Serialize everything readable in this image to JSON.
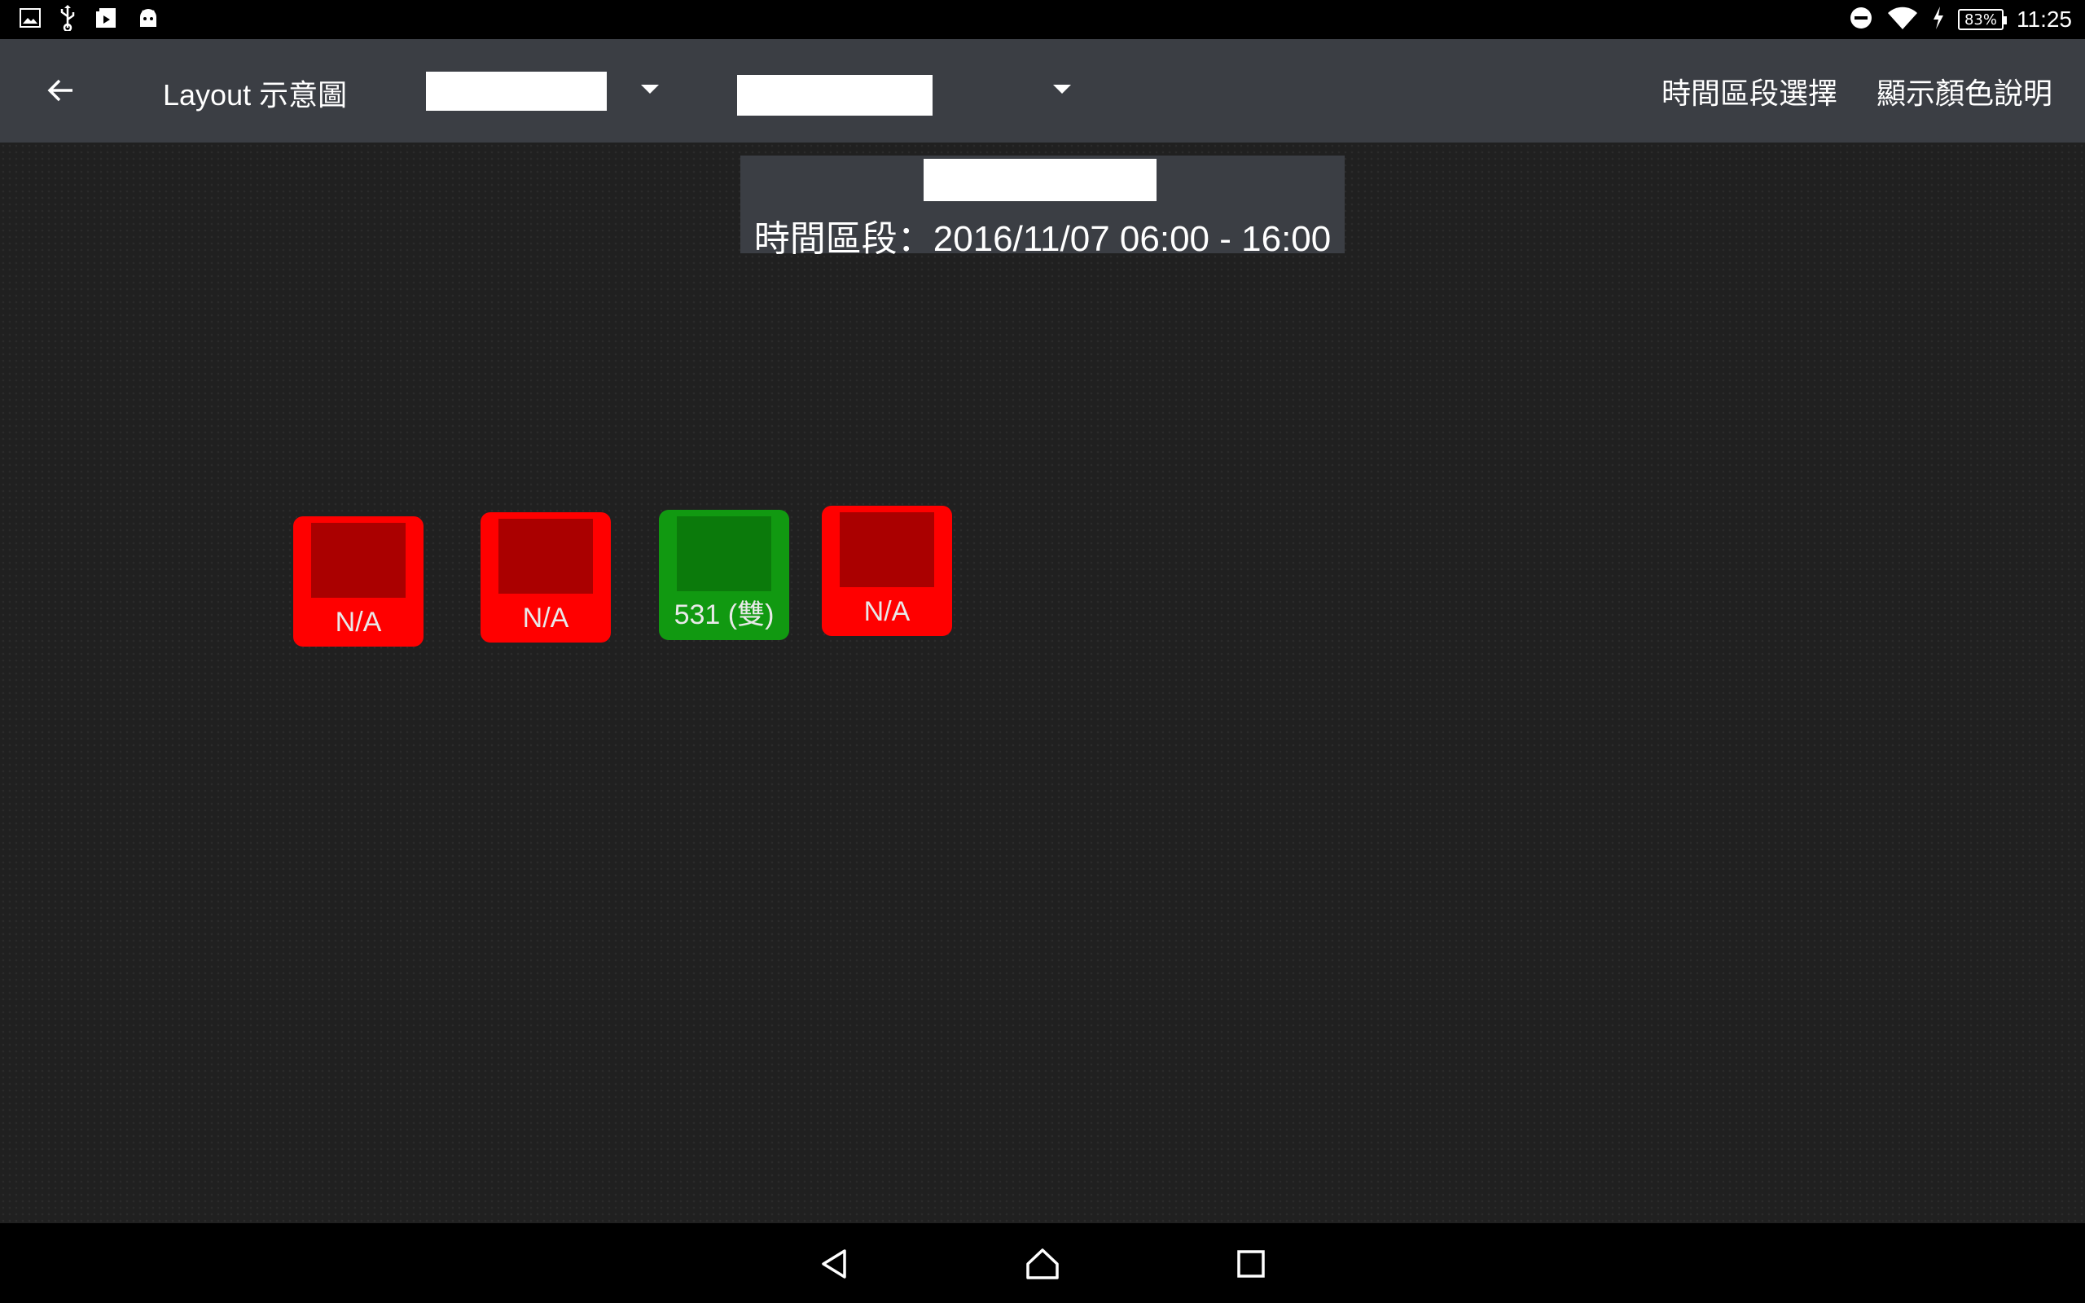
{
  "status_bar": {
    "battery_percent": "83%",
    "time": "11:25",
    "icons": [
      "picture-icon",
      "usb-icon",
      "video-icon",
      "android-icon",
      "dnd-icon",
      "wifi-icon",
      "charging-icon"
    ]
  },
  "app_bar": {
    "title": "Layout 示意圖",
    "actions": {
      "time_select": "時間區段選擇",
      "color_legend": "顯示顏色說明"
    }
  },
  "period": {
    "text": "時間區段：2016/11/07 06:00 - 16:00"
  },
  "machines": [
    {
      "label": "N/A",
      "status": "red"
    },
    {
      "label": "N/A",
      "status": "red"
    },
    {
      "label": "531 (雙)",
      "status": "green"
    },
    {
      "label": "N/A",
      "status": "red"
    }
  ],
  "colors": {
    "red_outer": "#ff0000",
    "red_inner": "#aa0000",
    "green_outer": "#119911",
    "green_inner": "#0b7a0b",
    "app_bar_bg": "#3b3e44",
    "content_bg": "#202020"
  }
}
